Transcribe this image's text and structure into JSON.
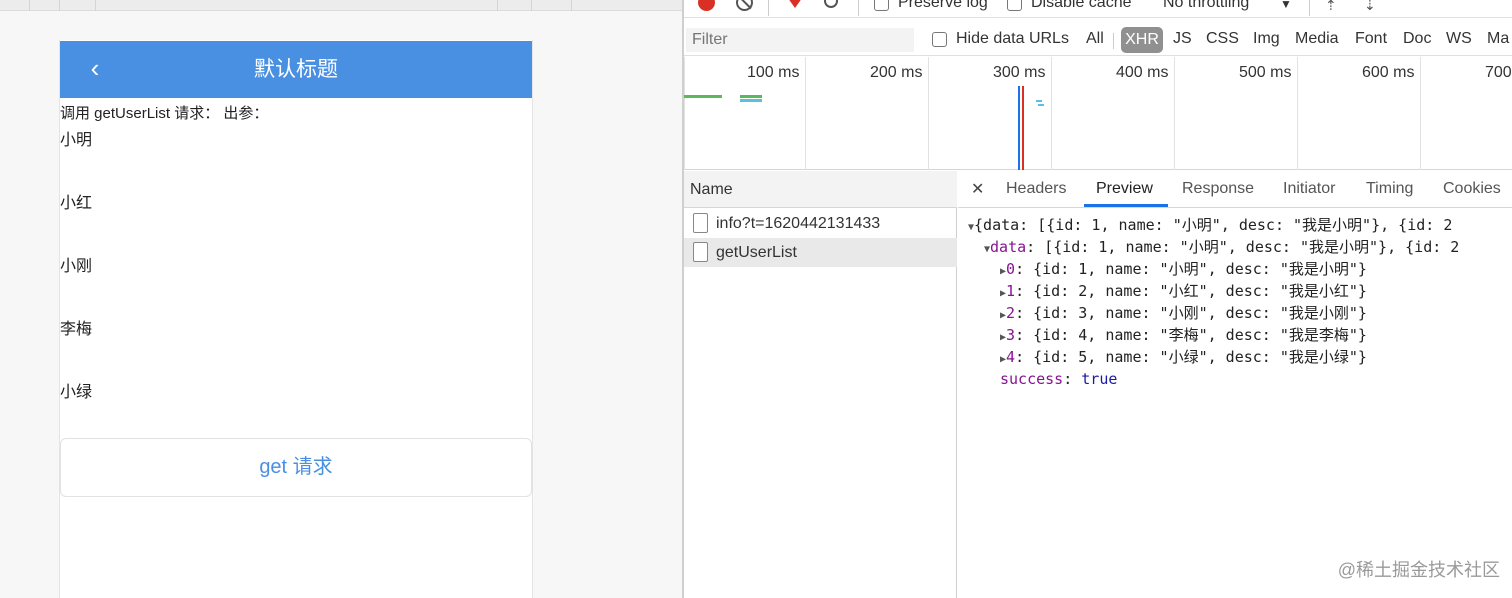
{
  "app": {
    "nav_title": "默认标题",
    "back_icon": "‹",
    "call_text": "调用 getUserList 请求：  出参：",
    "users": [
      "小明",
      "小红",
      "小刚",
      "李梅",
      "小绿"
    ],
    "get_button": "get 请求",
    "accent_color": "#4a90e2"
  },
  "devtools": {
    "toolbar": {
      "preserve_log": "Preserve log",
      "disable_cache": "Disable cache",
      "throttling": "No throttling",
      "throttling_caret": "▼"
    },
    "filter": {
      "placeholder": "Filter",
      "hide_data_urls": "Hide data URLs",
      "types": [
        "All",
        "XHR",
        "JS",
        "CSS",
        "Img",
        "Media",
        "Font",
        "Doc",
        "WS",
        "Ma"
      ],
      "active_type": "XHR"
    },
    "timeline_ticks": [
      "100 ms",
      "200 ms",
      "300 ms",
      "400 ms",
      "500 ms",
      "600 ms",
      "700"
    ],
    "name_header": "Name",
    "requests": [
      "info?t=1620442131433",
      "getUserList"
    ],
    "selected_request": "getUserList",
    "tabs": [
      "Headers",
      "Preview",
      "Response",
      "Initiator",
      "Timing",
      "Cookies"
    ],
    "active_tab": "Preview",
    "preview": {
      "root_line": "{data: [{id: 1, name: \"小明\", desc: \"我是小明\"}, {id: 2",
      "data_key": "data",
      "data_line": ": [{id: 1, name: \"小明\", desc: \"我是小明\"}, {id: 2",
      "items": [
        {
          "idx": "0",
          "text": ": {id: 1, name: \"小明\", desc: \"我是小明\"}"
        },
        {
          "idx": "1",
          "text": ": {id: 2, name: \"小红\", desc: \"我是小红\"}"
        },
        {
          "idx": "2",
          "text": ": {id: 3, name: \"小刚\", desc: \"我是小刚\"}"
        },
        {
          "idx": "3",
          "text": ": {id: 4, name: \"李梅\", desc: \"我是李梅\"}"
        },
        {
          "idx": "4",
          "text": ": {id: 5, name: \"小绿\", desc: \"我是小绿\"}"
        }
      ],
      "success_key": "success",
      "success_value": "true"
    }
  },
  "watermark": "@稀土掘金技术社区"
}
